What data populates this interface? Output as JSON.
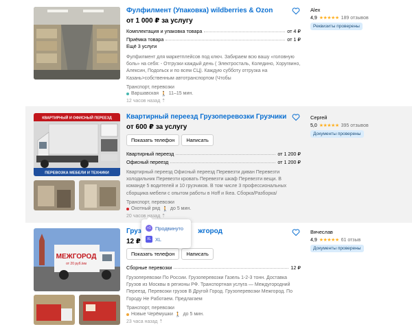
{
  "colors": {
    "title": "#0a6fd1",
    "badge_bg": "#d9ecfc",
    "star": "#ffb021",
    "metro_sviblovo": "#fd8b1c",
    "metro_okhotny": "#d7232b",
    "metro_cheryomushki": "#f0a73b"
  },
  "listings": [
    {
      "title": "Фулфилмент (Упаковка) wildberries & Ozon",
      "price": "от 1 000 ₽ за услугу",
      "services": [
        {
          "name": "Комплектация и упаковка товара",
          "price": "от 4 ₽"
        },
        {
          "name": "Приёмка товара",
          "price": "от 1 ₽"
        }
      ],
      "more": "Ещё 3 услуги",
      "description": "Фулфилмент для маркетплейсов под ключ. Забираем всю вашу «головную боль» на себя: - Отгрузки каждый день ( Электросталь, Коледино, Хоругвино, Алексин, Подольск и по всем СЦ). Каждую субботу отгрузка на Казань>собственным автотранспортом (Чтобы",
      "category": "Транспорт, перевозки",
      "metro": "Варшавская",
      "walk": "11–15 мин.",
      "ago": "12 часов назад",
      "seller": {
        "name": "Alex",
        "rating": "4,9",
        "stars": "★★★★★",
        "reviews": "189 отзывов",
        "badge": "Реквизиты проверены"
      }
    },
    {
      "title": "Квартирный переезд Грузоперевозки Грузчики",
      "price": "от 600 ₽ за услугу",
      "buttons": [
        "Показать телефон",
        "Написать"
      ],
      "services": [
        {
          "name": "Квартирный переезд",
          "price": "от 1 200 ₽"
        },
        {
          "name": "Офисный переезд",
          "price": "от 1 200 ₽"
        }
      ],
      "photo_text": {
        "top": "КВАРТИРНЫЙ И ОФИСНЫЙ ПЕРЕЕЗД",
        "bottom": "ПЕРЕВОЗКА МЕБЕЛИ И ТЕХНИКИ"
      },
      "description": "Квартирный переезд Офисный переезд Перевезти диван Перевезти холодильник Перевезти кровать Перевезти шкаф Перевезти вещи. В команде 5 водителей и 10 грузчиков. В том числе 3 профессиональных сборщика мебели с опытом работы в Hoff и Ikea. Сборка/Разборка/",
      "category": "Транспорт, перевозки",
      "metro": "Охотный ряд",
      "walk": "до 5 мин.",
      "ago": "20 часов назад",
      "seller": {
        "name": "Сергей",
        "rating": "5,0",
        "stars": "★★★★★",
        "reviews": "395 отзывов",
        "badge": "Документы проверены"
      }
    },
    {
      "title_left": "Грузо",
      "title_right": "жгород",
      "price_short": "12 ₽",
      "buttons": [
        "Показать телефон",
        "Написать"
      ],
      "services": [
        {
          "name": "Сборные перевозки",
          "price": "12 ₽"
        }
      ],
      "photo_text": {
        "main": "МЕЖГОРОД",
        "sub": "от 20 руб./км"
      },
      "description": "Грузоперевозки По России. Грузоперевозки Газель 1-2-3 тонн. Доставка Грузов из Москвы в регионы РФ. Транспортная услуга — Междугородний Переезд. Перевозки грузов В Другой Город. Грузоперевозки Межгород. По Городу Не Работаем. Предлагаем",
      "category": "Транспорт, перевозки",
      "metro": "Новые Черёмушки",
      "walk": "до 5 мин.",
      "ago": "23 часа назад",
      "seller": {
        "name": "Вячеслав",
        "rating": "4,9",
        "stars": "★★★★★",
        "reviews": "61 отзыв",
        "badge": "Документы проверены"
      }
    }
  ],
  "popup": {
    "items": [
      {
        "icon": "+1",
        "label": "Продвинуто"
      },
      {
        "icon": "XL",
        "label": "XL"
      }
    ]
  }
}
